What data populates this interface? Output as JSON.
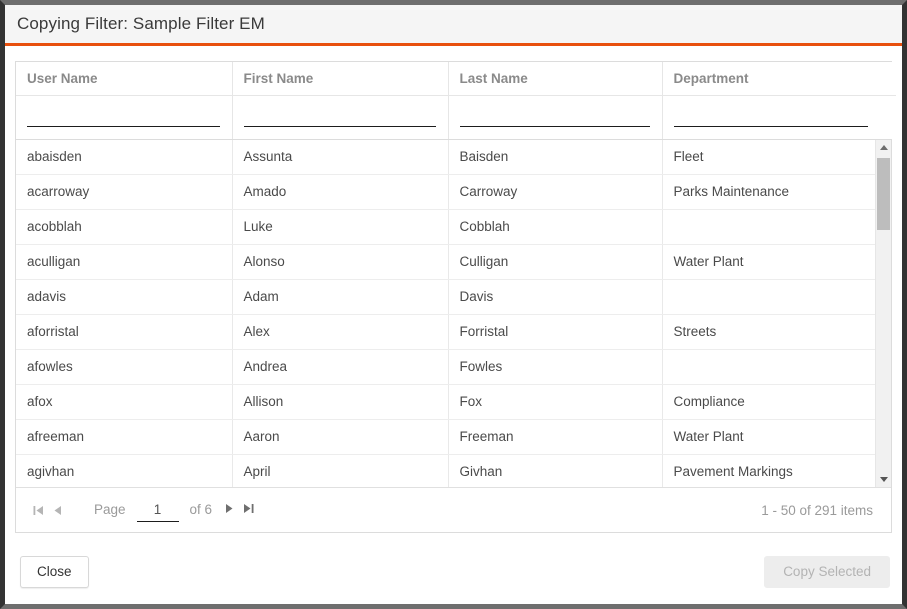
{
  "window": {
    "title": "Copying Filter: Sample Filter EM",
    "accent_color": "#e8500e"
  },
  "grid": {
    "columns": [
      {
        "key": "user_name",
        "label": "User Name",
        "filter_value": "",
        "filter_placeholder": ""
      },
      {
        "key": "first_name",
        "label": "First Name",
        "filter_value": "",
        "filter_placeholder": ""
      },
      {
        "key": "last_name",
        "label": "Last Name",
        "filter_value": "",
        "filter_placeholder": ""
      },
      {
        "key": "department",
        "label": "Department",
        "filter_value": "",
        "filter_placeholder": ""
      }
    ],
    "rows": [
      {
        "user_name": "abaisden",
        "first_name": "Assunta",
        "last_name": "Baisden",
        "department": "Fleet"
      },
      {
        "user_name": "acarroway",
        "first_name": "Amado",
        "last_name": "Carroway",
        "department": "Parks Maintenance"
      },
      {
        "user_name": "acobblah",
        "first_name": "Luke",
        "last_name": "Cobblah",
        "department": ""
      },
      {
        "user_name": "aculligan",
        "first_name": "Alonso",
        "last_name": "Culligan",
        "department": "Water Plant"
      },
      {
        "user_name": "adavis",
        "first_name": "Adam",
        "last_name": "Davis",
        "department": ""
      },
      {
        "user_name": "aforristal",
        "first_name": "Alex",
        "last_name": "Forristal",
        "department": "Streets"
      },
      {
        "user_name": "afowles",
        "first_name": "Andrea",
        "last_name": "Fowles",
        "department": ""
      },
      {
        "user_name": "afox",
        "first_name": "Allison",
        "last_name": "Fox",
        "department": "Compliance"
      },
      {
        "user_name": "afreeman",
        "first_name": "Aaron",
        "last_name": "Freeman",
        "department": "Water Plant"
      },
      {
        "user_name": "agivhan",
        "first_name": "April",
        "last_name": "Givhan",
        "department": "Pavement Markings"
      }
    ]
  },
  "pager": {
    "first_icon": "first-page-icon",
    "prev_icon": "previous-page-icon",
    "next_icon": "next-page-icon",
    "last_icon": "last-page-icon",
    "page_label": "Page",
    "page_value": "1",
    "of_label": "of 6",
    "items_summary": "1 - 50 of 291 items"
  },
  "footer": {
    "close_label": "Close",
    "copy_selected_label": "Copy Selected",
    "copy_selected_disabled": true
  },
  "scrollbar": {
    "up_icon": "scroll-up-arrow-icon",
    "down_icon": "scroll-down-arrow-icon"
  }
}
